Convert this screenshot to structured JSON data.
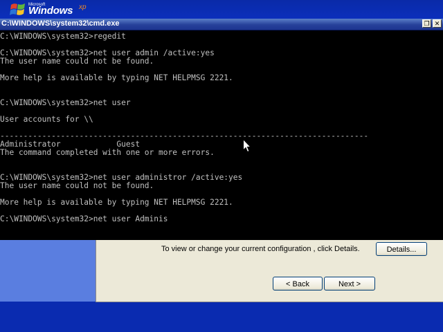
{
  "logo": {
    "microsoft": "Microsoft",
    "windows": "Windows",
    "xp": "xp"
  },
  "window": {
    "title": "C:\\WINDOWS\\system32\\cmd.exe",
    "icon_glyph": "C:\\",
    "restore_glyph": "❐",
    "close_glyph": "✕"
  },
  "console_lines": [
    "C:\\WINDOWS\\system32>regedit",
    "",
    "C:\\WINDOWS\\system32>net user admin /active:yes",
    "The user name could not be found.",
    "",
    "More help is available by typing NET HELPMSG 2221.",
    "",
    "",
    "C:\\WINDOWS\\system32>net user",
    "",
    "User accounts for \\\\",
    "",
    "-------------------------------------------------------------------------------",
    "Administrator            Guest",
    "The command completed with one or more errors.",
    "",
    "",
    "C:\\WINDOWS\\system32>net user administror /active:yes",
    "The user name could not be found.",
    "",
    "More help is available by typing NET HELPMSG 2221.",
    "",
    "C:\\WINDOWS\\system32>net user Adminis"
  ],
  "dialog": {
    "text": "To view or change your current configuration , click Details.",
    "details_label": "Details...",
    "back_label": "< Back",
    "next_label": "Next >"
  },
  "icons": {
    "cursor": "mouse-pointer-icon"
  },
  "colors": {
    "console_bg": "#000000",
    "console_text": "#c0c0c0",
    "titlebar": "#27419a",
    "desktop": "#0a2bb0",
    "dialog_bg": "#ece9d8"
  }
}
